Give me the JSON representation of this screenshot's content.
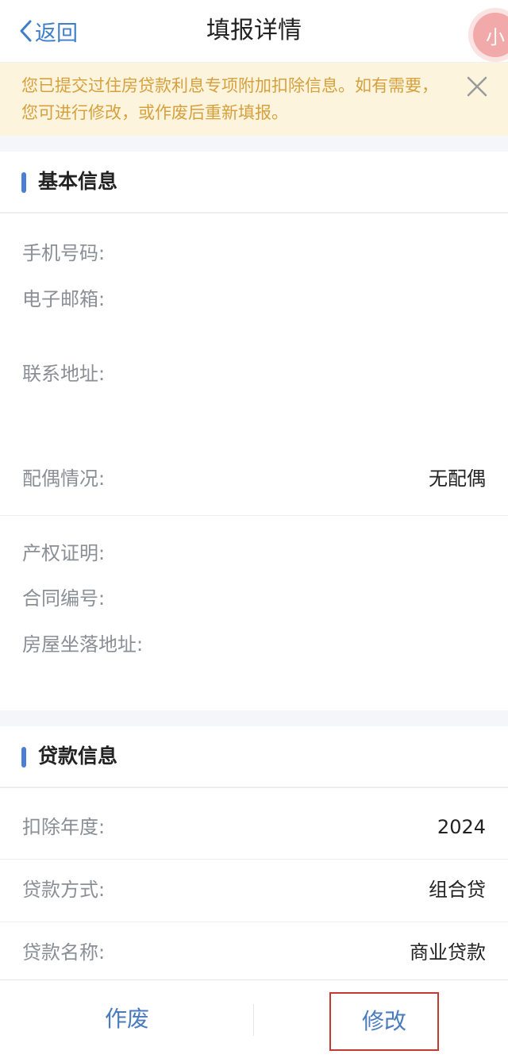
{
  "nav": {
    "back_label": "返回",
    "title": "填报详情",
    "floating_label": "小"
  },
  "notice": {
    "text": "您已提交过住房贷款利息专项附加扣除信息。如有需要，您可进行修改，或作废后重新填报。"
  },
  "basic_info": {
    "title": "基本信息",
    "phone_label": "手机号码:",
    "email_label": "电子邮箱:",
    "address_label": "联系地址:",
    "spouse_label": "配偶情况:",
    "spouse_value": "无配偶",
    "property_cert_label": "产权证明:",
    "contract_label": "合同编号:",
    "house_address_label": "房屋坐落地址:"
  },
  "loan_info": {
    "title": "贷款信息",
    "year_label": "扣除年度:",
    "year_value": "2024",
    "method_label": "贷款方式:",
    "method_value": "组合贷",
    "name_label": "贷款名称:",
    "name_value": "商业贷款"
  },
  "actions": {
    "void_label": "作废",
    "edit_label": "修改"
  },
  "colors": {
    "accent": "#4b7fd6",
    "notice_bg": "#fdf4de",
    "notice_text": "#d6a13d",
    "highlight_border": "#c23a32"
  }
}
